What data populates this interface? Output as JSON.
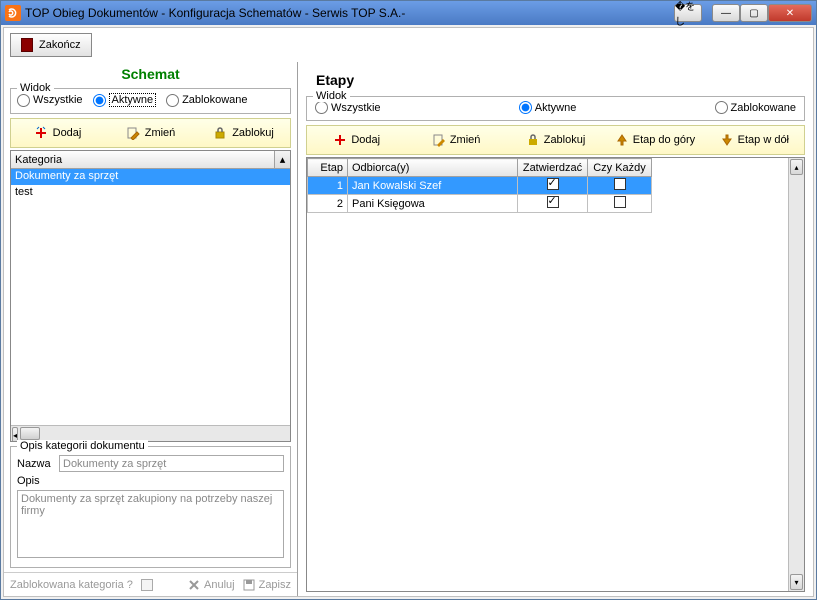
{
  "window": {
    "title": "TOP Obieg Dokumentów - Konfiguracja Schematów - Serwis TOP S.A.-"
  },
  "toolbar": {
    "close_label": "Zakończ"
  },
  "left": {
    "title": "Schemat",
    "view_group": "Widok",
    "view_all": "Wszystkie",
    "view_active": "Aktywne",
    "view_blocked": "Zablokowane",
    "actions": {
      "add": "Dodaj",
      "edit": "Zmień",
      "block": "Zablokuj"
    },
    "list_header": "Kategoria",
    "items": [
      {
        "label": "Dokumenty za sprzęt",
        "selected": true
      },
      {
        "label": "test",
        "selected": false
      }
    ],
    "details": {
      "legend": "Opis kategorii dokumentu",
      "name_label": "Nazwa",
      "name_value": "Dokumenty za sprzęt",
      "desc_label": "Opis",
      "desc_value": "Dokumenty za sprzęt zakupiony na potrzeby naszej firmy"
    },
    "bottom": {
      "blocked_q": "Zablokowana kategoria ?",
      "cancel": "Anuluj",
      "save": "Zapisz"
    }
  },
  "right": {
    "title": "Etapy",
    "view_group": "Widok",
    "view_all": "Wszystkie",
    "view_active": "Aktywne",
    "view_blocked": "Zablokowane",
    "actions": {
      "add": "Dodaj",
      "edit": "Zmień",
      "block": "Zablokuj",
      "up": "Etap do góry",
      "down": "Etap w dół"
    },
    "columns": {
      "etap": "Etap",
      "odbiorca": "Odbiorca(y)",
      "zatwierdzac": "Zatwierdzać",
      "czy_kazdy": "Czy Każdy"
    },
    "rows": [
      {
        "etap": "1",
        "odbiorca": "Jan Kowalski Szef",
        "zatw": true,
        "kazdy": false,
        "selected": true
      },
      {
        "etap": "2",
        "odbiorca": "Pani Księgowa",
        "zatw": true,
        "kazdy": false,
        "selected": false
      }
    ]
  }
}
